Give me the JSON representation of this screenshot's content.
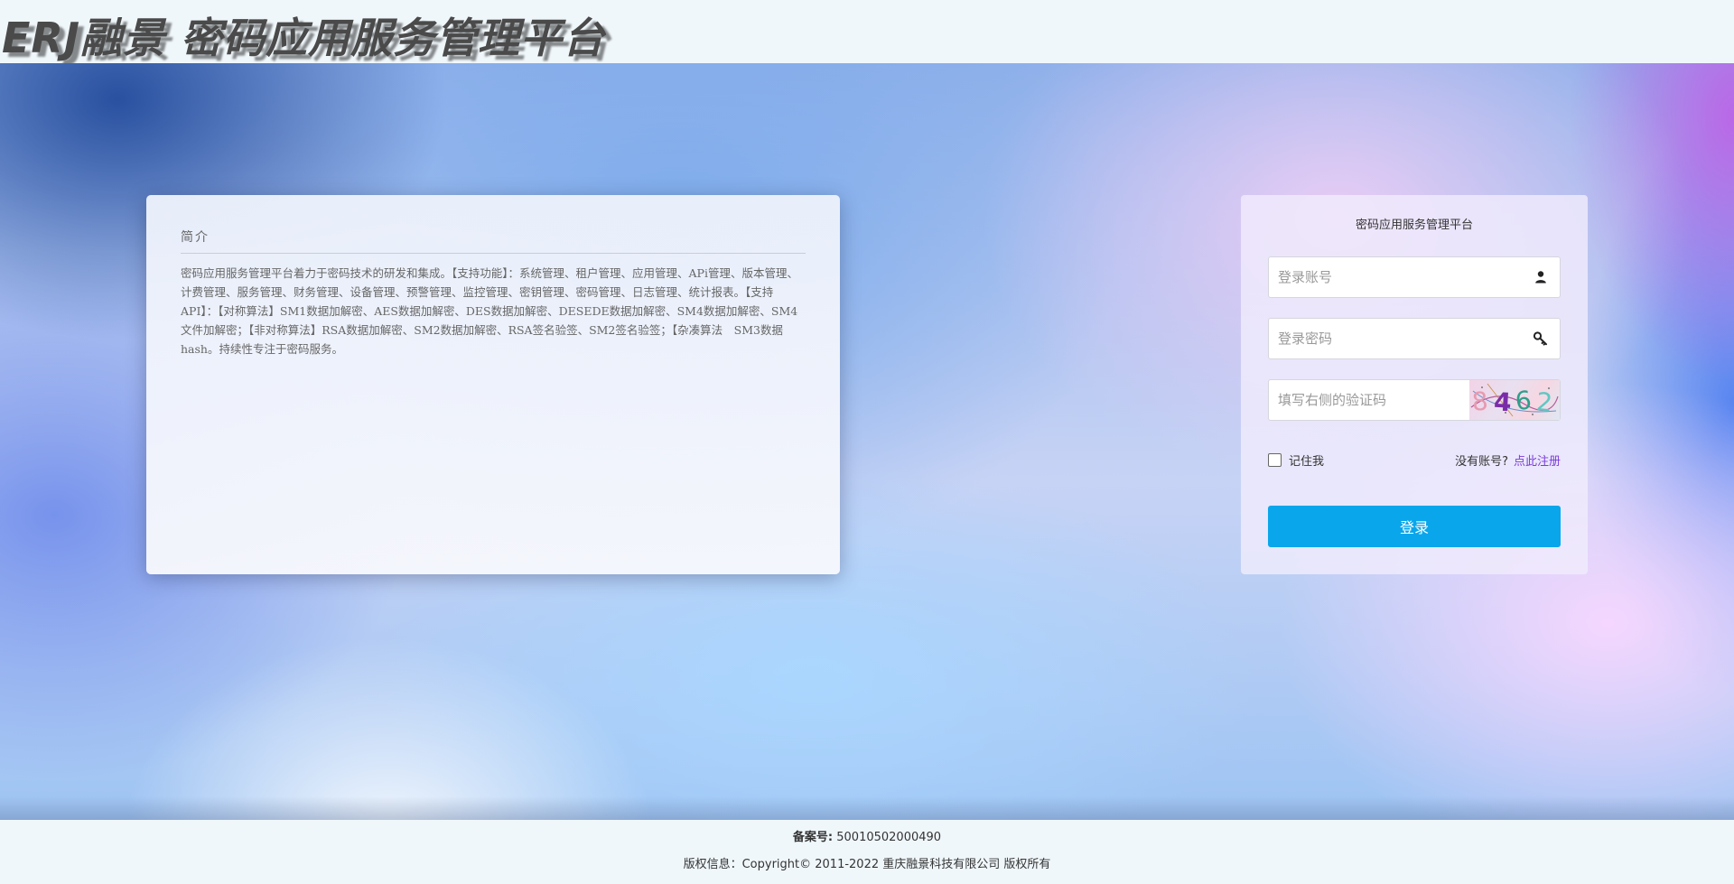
{
  "header": {
    "logo_text": "ERJ融景 密码应用服务管理平台"
  },
  "intro": {
    "title": "简介",
    "text": "密码应用服务管理平台着力于密码技术的研发和集成。【支持功能】：系统管理、租户管理、应用管理、APi管理、版本管理、计费管理、服务管理、财务管理、设备管理、预警管理、监控管理、密钥管理、密码管理、日志管理、统计报表。【支持API】：【对称算法】SM1数据加解密、AES数据加解密、DES数据加解密、DESEDE数据加解密、SM4数据加解密、SM4文件加解密；【非对称算法】RSA数据加解密、SM2数据加解密、RSA签名验签、SM2签名验签；【杂凑算法　SM3数据hash。持续性专注于密码服务。"
  },
  "login": {
    "title": "密码应用服务管理平台",
    "username_placeholder": "登录账号",
    "username_icon": "user-icon",
    "password_placeholder": "登录密码",
    "password_icon": "key-icon",
    "captcha_placeholder": "填写右侧的验证码",
    "captcha_code": "8462",
    "remember_label": "记住我",
    "remember_checked": false,
    "no_account_text": "没有账号?",
    "register_link": "点此注册",
    "submit_label": "登录"
  },
  "footer": {
    "record_label": "备案号:",
    "record_number": "50010502000490",
    "copyright": "版权信息：Copyright© 2011-2022 重庆融景科技有限公司 版权所有"
  },
  "colors": {
    "accent": "#0aa6eb",
    "link": "#7a3cd8",
    "page_bg": "#f0f7fb"
  }
}
